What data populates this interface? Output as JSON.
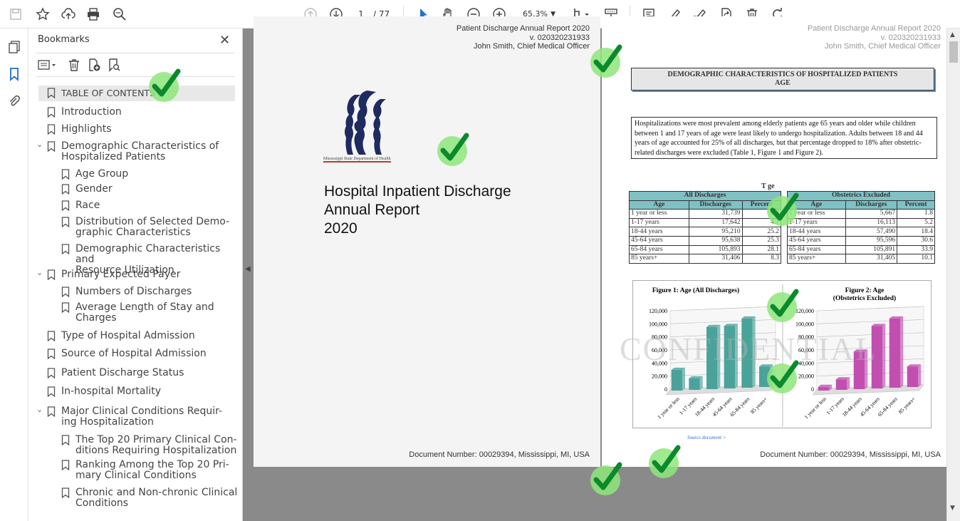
{
  "toolbar": {
    "page_current": "1",
    "page_total": "/ 77",
    "zoom": "65.3%"
  },
  "bookmarks": {
    "title": "Bookmarks",
    "items": [
      {
        "label": "TABLE OF CONTENTS"
      },
      {
        "label": "Introduction"
      },
      {
        "label": "Highlights"
      },
      {
        "label_1": "Demographic Characteristics of",
        "label_2": "Hospitalized Patients"
      },
      {
        "label": "Age Group"
      },
      {
        "label": "Gender"
      },
      {
        "label": "Race"
      },
      {
        "label_1": "Distribution of Selected Demo-",
        "label_2": "graphic Characteristics"
      },
      {
        "label_1": "Demographic Characteristics and",
        "label_2": "Resource Utilization"
      },
      {
        "label": "Primary Expected Payer"
      },
      {
        "label": "Numbers of Discharges"
      },
      {
        "label_1": "Average Length of Stay and",
        "label_2": "Charges"
      },
      {
        "label": "Type of Hospital Admission"
      },
      {
        "label": "Source of Hospital Admission"
      },
      {
        "label": "Patient Discharge Status"
      },
      {
        "label": "In-hospital Mortality"
      },
      {
        "label_1": "Major Clinical Conditions Requir-",
        "label_2": "ing Hospitalization"
      },
      {
        "label_1": "The Top 20 Primary Clinical Con-",
        "label_2": "ditions Requiring Hospitalization"
      },
      {
        "label_1": "Ranking Among the Top 20 Pri-",
        "label_2": "mary Clinical Conditions"
      },
      {
        "label_1": "Chronic and Non-chronic Clinical",
        "label_2": "Conditions"
      }
    ]
  },
  "left_page": {
    "header_1": "Patient Discharge Annual Report 2020",
    "header_2": "v. 020320231933",
    "header_3": "John Smith, Chief Medical Officer",
    "logo_text": "Mississippi State Department of Health",
    "title_1": "Hospital Inpatient Discharge",
    "title_2": "Annual Report",
    "title_3": "2020",
    "footer": "Document Number: 00029394, Mississippi, MI, USA"
  },
  "right_page": {
    "header_1": "Patient Discharge Annual Report 2020",
    "header_2": "v. 020320231933",
    "header_3": "John Smith, Chief Medical Officer",
    "section_1": "DEMOGRAPHIC CHARACTERISTICS OF HOSPITALIZED PATIENTS",
    "section_2": "AGE",
    "paragraph": "Hospitalizations were most prevalent among elderly patients age 65 years and older while children between 1 and 17 years of age were least likely to undergo hospitalization. Adults between 18 and 44 years of age accounted for 25% of all discharges, but that percentage dropped to 18% after obstetric-related discharges were excluded (Table 1, Figure 1 and Figure 2).",
    "table_title": "T       ge",
    "table_left_group": "All Discharges",
    "table_right_group": "Obstetrics Excluded",
    "col_age": "Age",
    "col_discharges": "Discharges",
    "col_percent": "Percent",
    "rows_all": [
      {
        "age": "1 year or less",
        "d": "31,739",
        "p": "8.4"
      },
      {
        "age": "1-17 years",
        "d": "17,642",
        "p": "4.7"
      },
      {
        "age": "18-44 years",
        "d": "95,210",
        "p": "25.2"
      },
      {
        "age": "45-64 years",
        "d": "95,638",
        "p": "25.3"
      },
      {
        "age": "65-84 years",
        "d": "105,893",
        "p": "28.1"
      },
      {
        "age": "85 years+",
        "d": "31,406",
        "p": "8.3"
      }
    ],
    "rows_obs": [
      {
        "age": "1 year or less",
        "d": "5,667",
        "p": "1.8"
      },
      {
        "age": "1-17 years",
        "d": "16,113",
        "p": "5.2"
      },
      {
        "age": "18-44 years",
        "d": "57,490",
        "p": "18.4"
      },
      {
        "age": "45-64 years",
        "d": "95,596",
        "p": "30.6"
      },
      {
        "age": "65-84 years",
        "d": "105,891",
        "p": "33.9"
      },
      {
        "age": "85 years+",
        "d": "31,405",
        "p": "10.1"
      }
    ],
    "fig1_title": "Figure 1:  Age  (All Discharges)",
    "fig2_title_1": "Figure 2: Age",
    "fig2_title_2": "(Obstetrics Excluded)",
    "watermark": "CONFIDENTIAL",
    "source_link": "Source document >",
    "footer": "Document Number: 00029394, Mississippi, MI, USA"
  },
  "chart_data": [
    {
      "type": "bar",
      "title": "Figure 1:  Age  (All Discharges)",
      "categories": [
        "1 year or less",
        "1-17 years",
        "18-44 years",
        "45-64 years",
        "65-84 years",
        "85 years+"
      ],
      "values": [
        31739,
        17642,
        95210,
        95638,
        105893,
        31406
      ],
      "yticks": [
        "0",
        "20,000",
        "40,000",
        "60,000",
        "80,000",
        "100,000",
        "120,000"
      ],
      "ylim": [
        0,
        120000
      ],
      "color": "#4aa39a"
    },
    {
      "type": "bar",
      "title": "Figure 2: Age (Obstetrics Excluded)",
      "categories": [
        "1 year or less",
        "1-17 years",
        "18-44 years",
        "45-64 years",
        "65-84 years",
        "85 years+"
      ],
      "values": [
        5667,
        16113,
        57490,
        95596,
        105891,
        31405
      ],
      "yticks": [
        "0",
        "20,000",
        "40,000",
        "60,000",
        "80,000",
        "100,000",
        "120,000"
      ],
      "ylim": [
        0,
        120000
      ],
      "color": "#c24fb0"
    }
  ]
}
